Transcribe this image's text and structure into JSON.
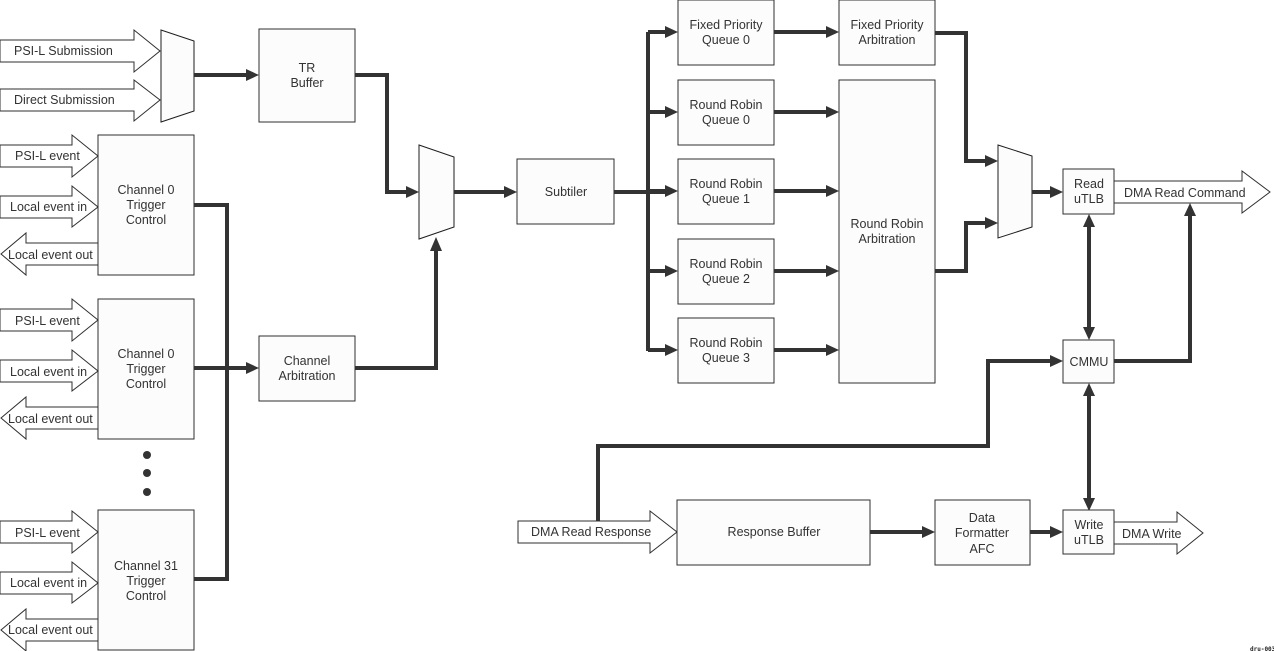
{
  "diagram": {
    "figure_tag": "dru-003",
    "inputs": {
      "psil_submission": "PSI-L Submission",
      "direct_submission": "Direct Submission"
    },
    "tr_buffer": [
      "TR",
      "Buffer"
    ],
    "channels": [
      {
        "title": [
          "Channel 0",
          "Trigger",
          "Control"
        ],
        "psil_event": "PSI-L event",
        "local_event_in": "Local event in",
        "local_event_out": "Local event out"
      },
      {
        "title": [
          "Channel 0",
          "Trigger",
          "Control"
        ],
        "psil_event": "PSI-L event",
        "local_event_in": "Local event in",
        "local_event_out": "Local event out"
      },
      {
        "title": [
          "Channel 31",
          "Trigger",
          "Control"
        ],
        "psil_event": "PSI-L event",
        "local_event_in": "Local event in",
        "local_event_out": "Local event out"
      }
    ],
    "ellipsis": "...",
    "channel_arbitration": [
      "Channel",
      "Arbitration"
    ],
    "subtiler": "Subtiler",
    "queues": [
      [
        "Fixed Priority",
        "Queue 0"
      ],
      [
        "Round Robin",
        "Queue 0"
      ],
      [
        "Round Robin",
        "Queue 1"
      ],
      [
        "Round Robin",
        "Queue 2"
      ],
      [
        "Round Robin",
        "Queue 3"
      ]
    ],
    "fixed_priority_arbitration": [
      "Fixed Priority",
      "Arbitration"
    ],
    "round_robin_arbitration": [
      "Round Robin",
      "Arbitration"
    ],
    "read_utlb": [
      "Read",
      "uTLB"
    ],
    "dma_read_command": "DMA Read Command",
    "cmmu": "CMMU",
    "dma_read_response": "DMA Read Response",
    "response_buffer": "Response Buffer",
    "data_formatter": [
      "Data",
      "Formatter",
      "AFC"
    ],
    "write_utlb": [
      "Write",
      "uTLB"
    ],
    "dma_write": "DMA Write"
  }
}
